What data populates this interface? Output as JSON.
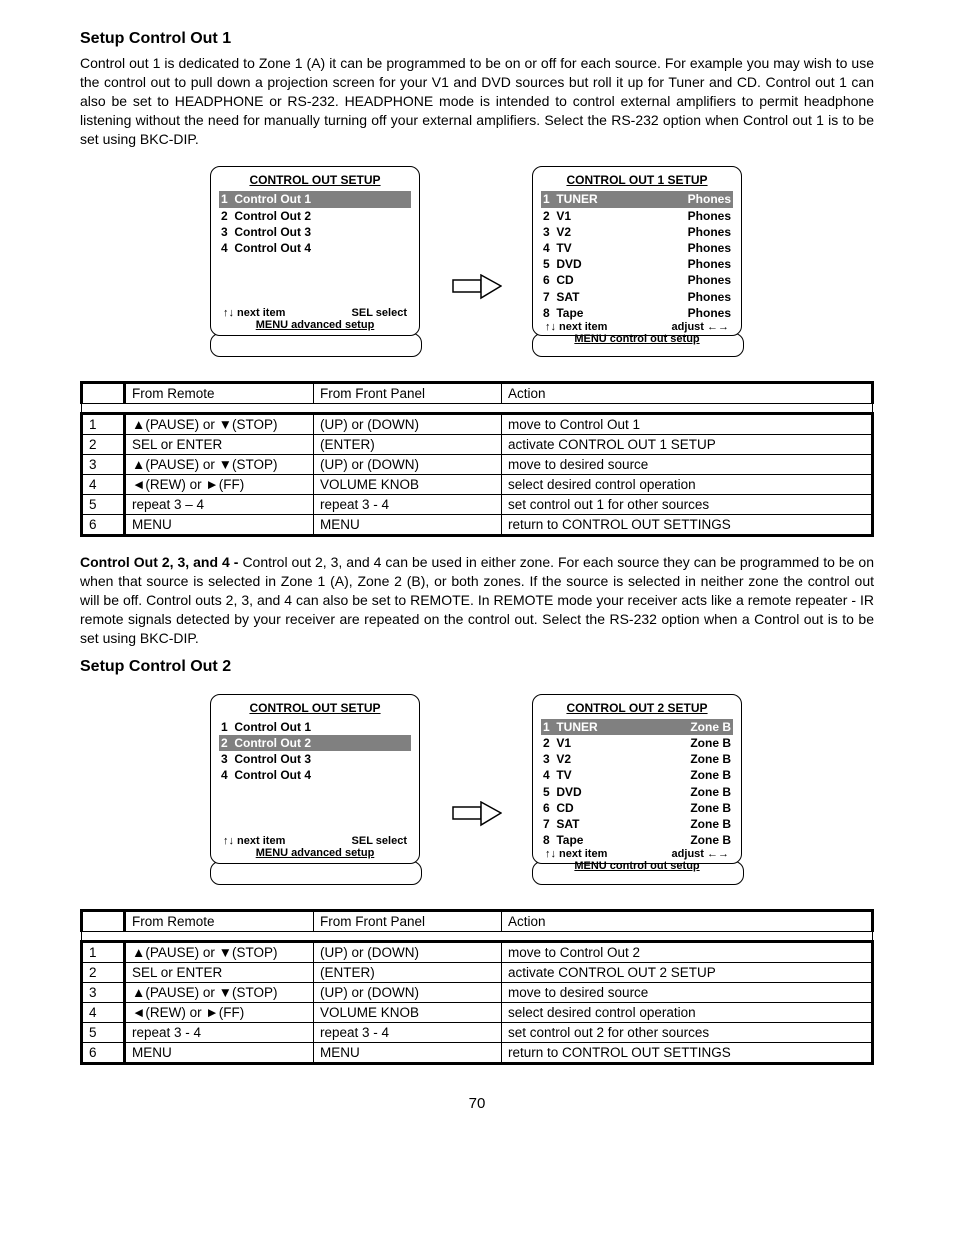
{
  "page_number": "70",
  "section1": {
    "heading": "Setup Control Out 1",
    "para": "Control out 1 is dedicated to Zone 1 (A) it can be programmed to be on or off for each source. For example you may wish to use the control out to pull down a projection screen for your V1 and DVD sources but roll it up for Tuner and CD. Control out 1 can also be set to HEADPHONE or RS-232. HEADPHONE mode is intended to control external amplifiers to permit headphone listening without the need for manually turning off your external amplifiers. Select the RS-232 option when Control out 1 is to be set using BKC-DIP.",
    "screenA": {
      "title": "CONTROL OUT SETUP",
      "rows": [
        {
          "n": "1",
          "label": "Control Out 1",
          "hl": true
        },
        {
          "n": "2",
          "label": "Control Out 2",
          "hl": false
        },
        {
          "n": "3",
          "label": "Control Out 3",
          "hl": false
        },
        {
          "n": "4",
          "label": "Control Out 4",
          "hl": false
        }
      ],
      "foot_left": "↑↓  next item",
      "foot_right": "SEL  select",
      "foot_bottom": "MENU  advanced setup"
    },
    "screenB": {
      "title": "CONTROL OUT 1 SETUP",
      "rows": [
        {
          "n": "1",
          "label": "TUNER",
          "val": "Phones",
          "hl": true
        },
        {
          "n": "2",
          "label": "V1",
          "val": "Phones",
          "hl": false
        },
        {
          "n": "3",
          "label": "V2",
          "val": "Phones",
          "hl": false
        },
        {
          "n": "4",
          "label": "TV",
          "val": "Phones",
          "hl": false
        },
        {
          "n": "5",
          "label": "DVD",
          "val": "Phones",
          "hl": false
        },
        {
          "n": "6",
          "label": "CD",
          "val": "Phones",
          "hl": false
        },
        {
          "n": "7",
          "label": "SAT",
          "val": "Phones",
          "hl": false
        },
        {
          "n": "8",
          "label": "Tape",
          "val": "Phones",
          "hl": false
        }
      ],
      "foot_left": "↑↓ next item",
      "foot_right": "adjust  ←→",
      "foot_bottom": "MENU  control out setup"
    },
    "table": {
      "h1": "From Remote",
      "h2": "From Front Panel",
      "h3": "Action",
      "rows": [
        {
          "n": "1",
          "r": "▲(PAUSE) or ▼(STOP)",
          "f": "(UP) or (DOWN)",
          "a": "move to Control Out 1"
        },
        {
          "n": "2",
          "r": "SEL or ENTER",
          "f": "(ENTER)",
          "a": "activate CONTROL OUT 1 SETUP"
        },
        {
          "n": "3",
          "r": "▲(PAUSE) or ▼(STOP)",
          "f": "(UP) or (DOWN)",
          "a": "move to desired source"
        },
        {
          "n": "4",
          "r": "◄(REW) or ►(FF)",
          "f": "VOLUME KNOB",
          "a": "select desired control operation"
        },
        {
          "n": "5",
          "r": "repeat 3 – 4",
          "f": "repeat 3 - 4",
          "a": "set control out 1 for other sources"
        },
        {
          "n": "6",
          "r": "MENU",
          "f": "MENU",
          "a": "return to CONTROL OUT SETTINGS"
        }
      ]
    }
  },
  "midpara_bold": "Control Out 2, 3, and 4 - ",
  "midpara": "Control out 2, 3, and 4 can be used in either zone. For each source they can be programmed to be on when that source is selected in Zone 1 (A), Zone 2 (B), or both zones. If the source is selected in neither zone the control out will be off. Control outs 2, 3, and 4 can also be set to REMOTE. In REMOTE mode your receiver acts like a remote repeater - IR remote signals detected by your receiver are repeated on the control out. Select the RS-232 option when a Control out is to be set using BKC-DIP.",
  "section2": {
    "heading": "Setup Control Out 2",
    "screenA": {
      "title": "CONTROL OUT SETUP",
      "rows": [
        {
          "n": "1",
          "label": "Control Out 1",
          "hl": false
        },
        {
          "n": "2",
          "label": "Control Out 2",
          "hl": true
        },
        {
          "n": "3",
          "label": "Control Out 3",
          "hl": false
        },
        {
          "n": "4",
          "label": "Control Out 4",
          "hl": false
        }
      ],
      "foot_left": "↑↓  next item",
      "foot_right": "SEL  select",
      "foot_bottom": "MENU  advanced setup"
    },
    "screenB": {
      "title": "CONTROL OUT 2 SETUP",
      "rows": [
        {
          "n": "1",
          "label": "TUNER",
          "val": "Zone B",
          "hl": true
        },
        {
          "n": "2",
          "label": "V1",
          "val": "Zone B",
          "hl": false
        },
        {
          "n": "3",
          "label": "V2",
          "val": "Zone B",
          "hl": false
        },
        {
          "n": "4",
          "label": "TV",
          "val": "Zone B",
          "hl": false
        },
        {
          "n": "5",
          "label": "DVD",
          "val": "Zone B",
          "hl": false
        },
        {
          "n": "6",
          "label": "CD",
          "val": "Zone B",
          "hl": false
        },
        {
          "n": "7",
          "label": "SAT",
          "val": "Zone B",
          "hl": false
        },
        {
          "n": "8",
          "label": "Tape",
          "val": "Zone B",
          "hl": false
        }
      ],
      "foot_left": "↑↓ next item",
      "foot_right": "adjust  ←→",
      "foot_bottom": "MENU  control out setup"
    },
    "table": {
      "h1": "From Remote",
      "h2": "From Front Panel",
      "h3": "Action",
      "rows": [
        {
          "n": "1",
          "r": "▲(PAUSE) or ▼(STOP)",
          "f": "(UP) or (DOWN)",
          "a": "move to Control Out 2"
        },
        {
          "n": "2",
          "r": "SEL or ENTER",
          "f": "(ENTER)",
          "a": "activate CONTROL OUT 2 SETUP"
        },
        {
          "n": "3",
          "r": "▲(PAUSE) or ▼(STOP)",
          "f": "(UP) or (DOWN)",
          "a": "move to desired source"
        },
        {
          "n": "4",
          "r": "◄(REW) or ►(FF)",
          "f": "VOLUME KNOB",
          "a": "select desired control operation"
        },
        {
          "n": "5",
          "r": "repeat 3 - 4",
          "f": "repeat 3 - 4",
          "a": "set control out 2 for other sources"
        },
        {
          "n": "6",
          "r": "MENU",
          "f": "MENU",
          "a": "return to CONTROL OUT SETTINGS"
        }
      ]
    }
  }
}
